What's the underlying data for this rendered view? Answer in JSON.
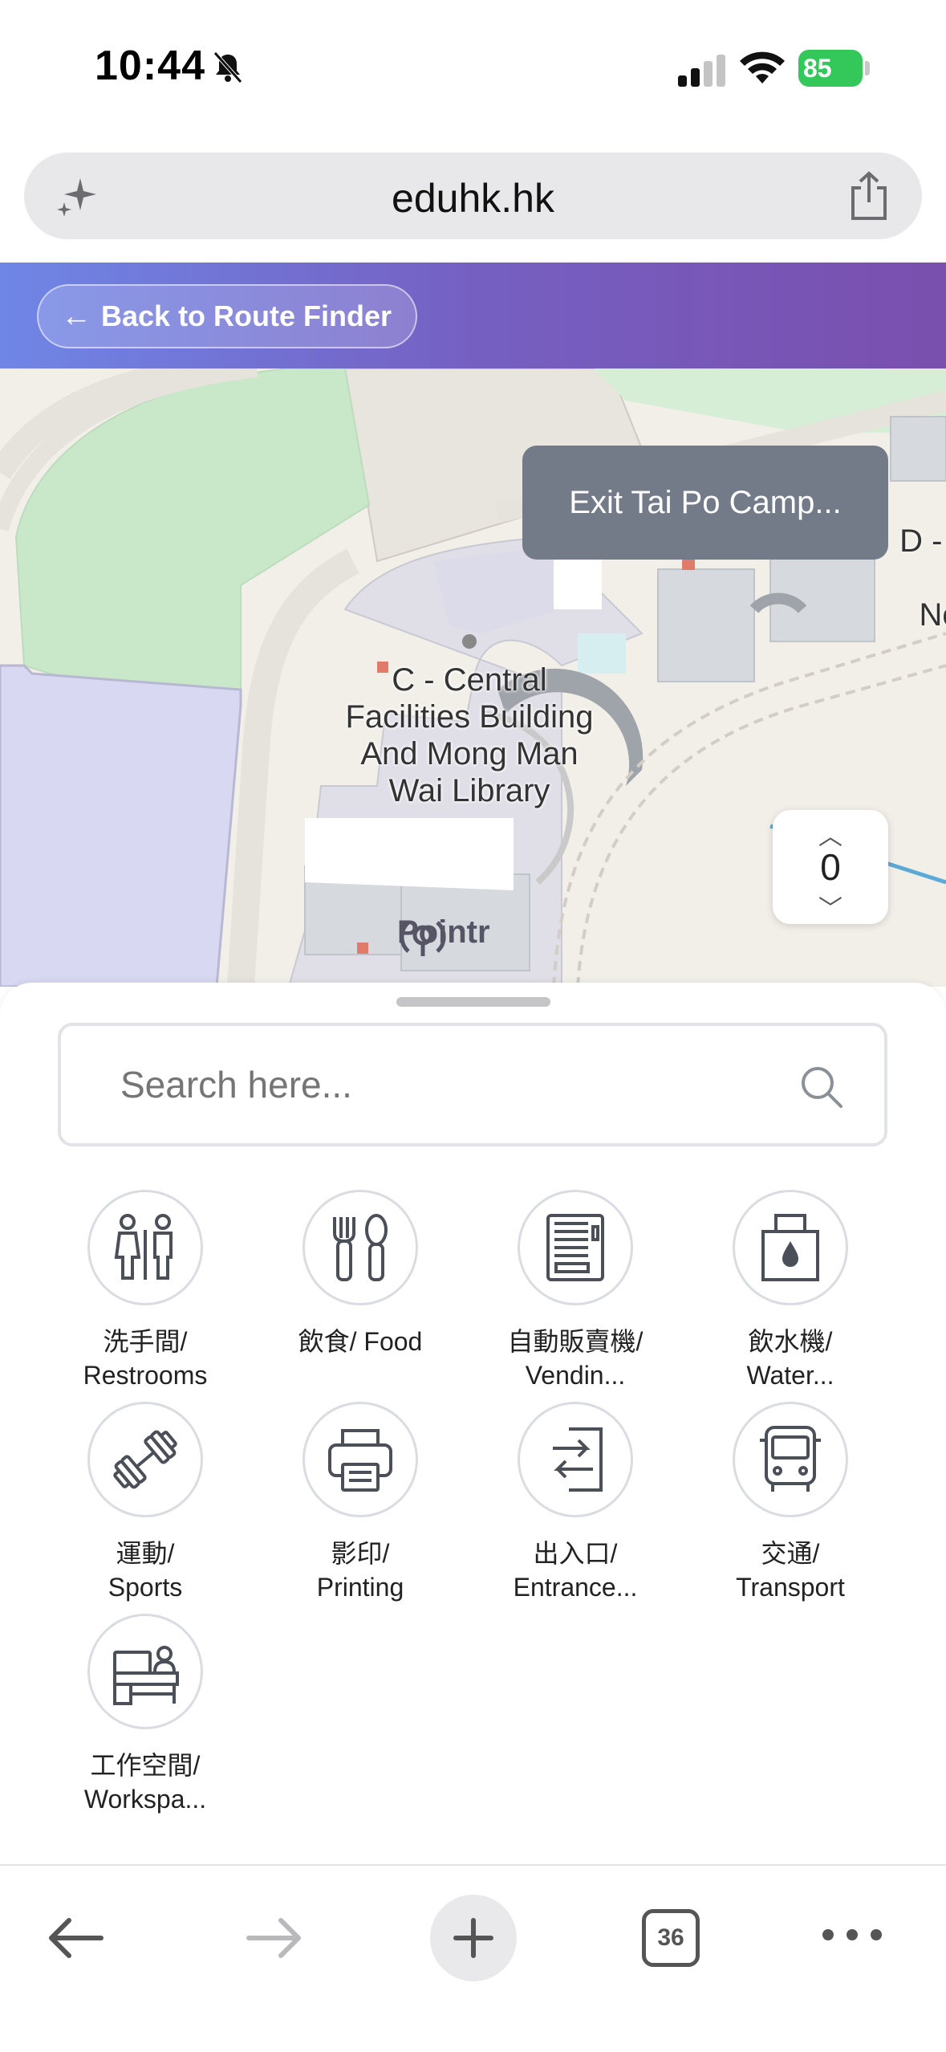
{
  "status_bar": {
    "time": "10:44",
    "battery": "85",
    "icons": [
      "bell-slash-icon",
      "cellular-signal-icon",
      "wifi-icon",
      "battery-charging-icon"
    ]
  },
  "browser": {
    "url": "eduhk.hk",
    "icons": [
      "sparkle-icon",
      "share-icon"
    ]
  },
  "header": {
    "back_label": "Back to Route Finder"
  },
  "map": {
    "building_label": "C - Central Facilities Building And Mong Man Wai Library",
    "side_label": "D - A\nB\nNor",
    "exit_tooltip": "Exit Tai Po Camp...",
    "floor_level": "0",
    "provider_logo": "Pointr"
  },
  "sheet": {
    "search_placeholder": "Search here...",
    "categories": [
      {
        "icon": "restroom-icon",
        "line1": "洗手間/",
        "line2": "Restrooms"
      },
      {
        "icon": "food-icon",
        "line1": "飲食/ Food",
        "line2": ""
      },
      {
        "icon": "vending-machine-icon",
        "line1": "自動販賣機/",
        "line2": "Vendin..."
      },
      {
        "icon": "water-dispenser-icon",
        "line1": "飲水機/",
        "line2": "Water..."
      },
      {
        "icon": "dumbbell-icon",
        "line1": "運動/",
        "line2": "Sports"
      },
      {
        "icon": "printer-icon",
        "line1": "影印/",
        "line2": "Printing"
      },
      {
        "icon": "entrance-icon",
        "line1": "出入口/",
        "line2": "Entrance..."
      },
      {
        "icon": "bus-icon",
        "line1": "交通/",
        "line2": "Transport"
      },
      {
        "icon": "workspace-icon",
        "line1": "工作空間/",
        "line2": "Workspa..."
      }
    ]
  },
  "toolbar": {
    "tab_count": "36",
    "icons": [
      "back-arrow-icon",
      "forward-arrow-icon",
      "new-tab-plus-icon",
      "tabs-icon",
      "more-icon"
    ]
  },
  "colors": {
    "header_gradient_start": "#6f86e6",
    "header_gradient_end": "#7a4fae",
    "tooltip_bg": "#737a88",
    "battery_green": "#34c759"
  }
}
